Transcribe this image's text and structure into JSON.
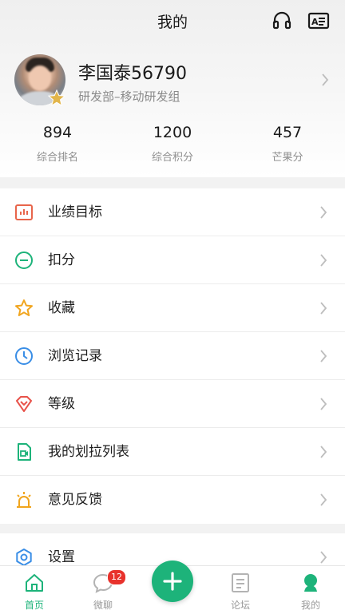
{
  "header": {
    "title": "我的",
    "icons": [
      "headphones-icon",
      "contact-card-icon"
    ]
  },
  "profile": {
    "name": "李国泰56790",
    "department": "研发部–移动研发组"
  },
  "stats": [
    {
      "value": "894",
      "label": "综合排名"
    },
    {
      "value": "1200",
      "label": "综合积分"
    },
    {
      "value": "457",
      "label": "芒果分"
    }
  ],
  "menu": [
    {
      "label": "业绩目标",
      "icon": "bar-chart-icon",
      "color": "#e8654b"
    },
    {
      "label": "扣分",
      "icon": "minus-circle-icon",
      "color": "#1db37a"
    },
    {
      "label": "收藏",
      "icon": "star-icon",
      "color": "#f1a51e"
    },
    {
      "label": "浏览记录",
      "icon": "clock-icon",
      "color": "#3a8ee6"
    },
    {
      "label": "等级",
      "icon": "diamond-heart-icon",
      "color": "#e8534b"
    },
    {
      "label": "我的划拉列表",
      "icon": "video-file-icon",
      "color": "#1db37a"
    },
    {
      "label": "意见反馈",
      "icon": "alarm-light-icon",
      "color": "#f1a51e"
    }
  ],
  "menu2": [
    {
      "label": "设置",
      "icon": "gear-icon",
      "color": "#3a8ee6"
    }
  ],
  "tabbar": {
    "tabs": [
      {
        "label": "首页",
        "icon": "home-icon",
        "active": true
      },
      {
        "label": "微聊",
        "icon": "chat-bubble-icon",
        "badge": "12"
      },
      {
        "label": "",
        "icon": "plus-icon"
      },
      {
        "label": "论坛",
        "icon": "document-icon"
      },
      {
        "label": "我的",
        "icon": "person-icon"
      }
    ]
  },
  "colors": {
    "accent": "#1db37a",
    "badge": "#e8322c",
    "text_secondary": "#8a8a8a"
  }
}
